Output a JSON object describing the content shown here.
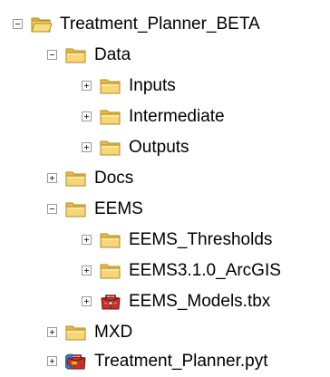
{
  "tree": {
    "nodes": [
      {
        "label": "Treatment_Planner_BETA",
        "state": "collapse",
        "icon": "folder-open-icon"
      },
      {
        "label": "Data",
        "state": "collapse",
        "icon": "folder-icon"
      },
      {
        "label": "Inputs",
        "state": "expand",
        "icon": "folder-icon"
      },
      {
        "label": "Intermediate",
        "state": "expand",
        "icon": "folder-icon"
      },
      {
        "label": "Outputs",
        "state": "expand",
        "icon": "folder-icon"
      },
      {
        "label": "Docs",
        "state": "expand",
        "icon": "folder-icon"
      },
      {
        "label": "EEMS",
        "state": "collapse",
        "icon": "folder-icon"
      },
      {
        "label": "EEMS_Thresholds",
        "state": "expand",
        "icon": "folder-icon"
      },
      {
        "label": "EEMS3.1.0_ArcGIS",
        "state": "expand",
        "icon": "folder-icon"
      },
      {
        "label": "EEMS_Models.tbx",
        "state": "expand",
        "icon": "toolbox-red-icon"
      },
      {
        "label": "MXD",
        "state": "expand",
        "icon": "folder-icon"
      },
      {
        "label": "Treatment_Planner.pyt",
        "state": "expand",
        "icon": "python-toolbox-icon"
      }
    ]
  }
}
